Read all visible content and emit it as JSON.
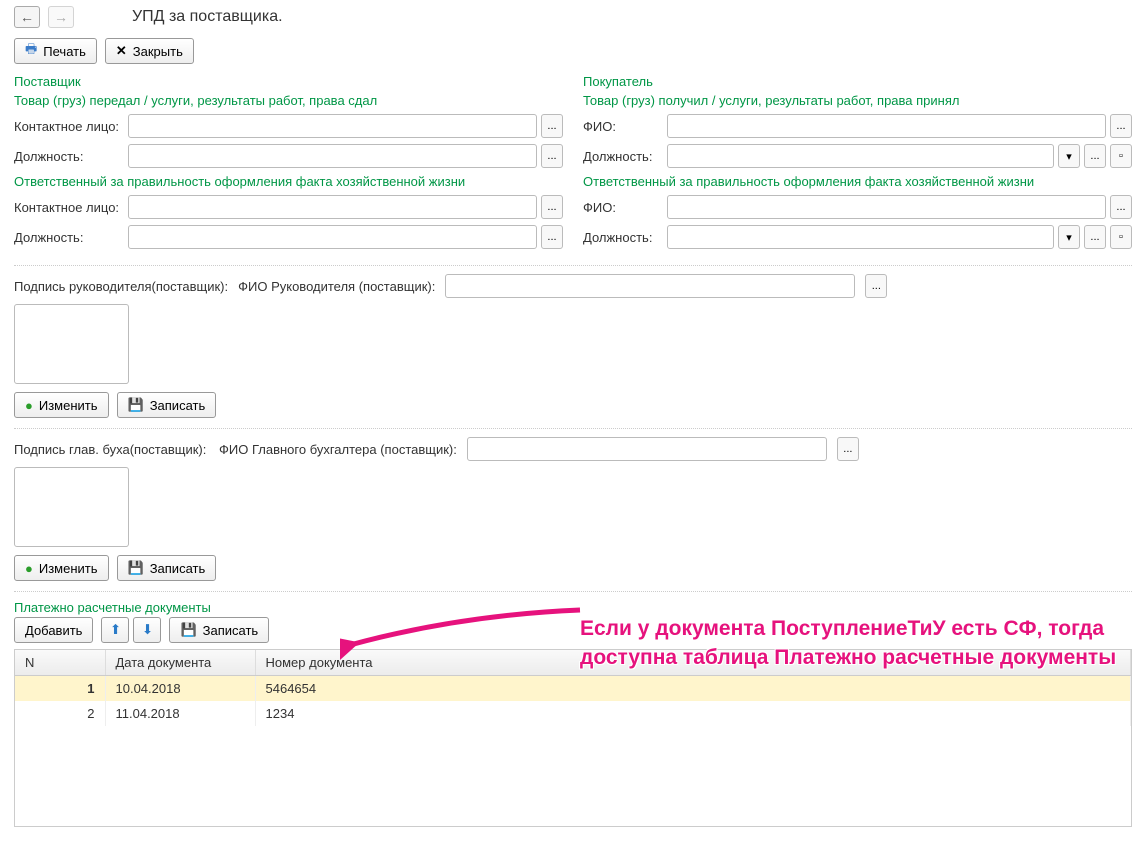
{
  "header": {
    "title": "УПД за поставщика."
  },
  "toolbar": {
    "print": "Печать",
    "close": "Закрыть"
  },
  "supplier": {
    "title": "Поставщик",
    "sub1": "Товар (груз) передал / услуги, результаты работ, права сдал",
    "contact_label": "Контактное лицо:",
    "position_label": "Должность:",
    "sub2": "Ответственный за правильность оформления факта хозяйственной жизни"
  },
  "buyer": {
    "title": "Покупатель",
    "sub1": "Товар (груз) получил / услуги, результаты работ, права принял",
    "fio_label": "ФИО:",
    "position_label": "Должность:",
    "sub2": "Ответственный за правильность оформления факта хозяйственной жизни"
  },
  "sig1": {
    "label": "Подпись руководителя(поставщик):",
    "fio_label": "ФИО Руководителя (поставщик):",
    "change": "Изменить",
    "save": "Записать"
  },
  "sig2": {
    "label": "Подпись глав. буха(поставщик):",
    "fio_label": "ФИО Главного бухгалтера (поставщик):",
    "change": "Изменить",
    "save": "Записать"
  },
  "docs": {
    "title": "Платежно расчетные документы",
    "add": "Добавить",
    "save": "Записать",
    "columns": {
      "n": "N",
      "date": "Дата документа",
      "num": "Номер документа"
    },
    "rows": [
      {
        "n": "1",
        "date": "10.04.2018",
        "num": "5464654"
      },
      {
        "n": "2",
        "date": "11.04.2018",
        "num": "1234"
      }
    ]
  },
  "annotation": "Если у документа ПоступлениеТиУ есть СФ, тогда доступна таблица Платежно расчетные документы"
}
